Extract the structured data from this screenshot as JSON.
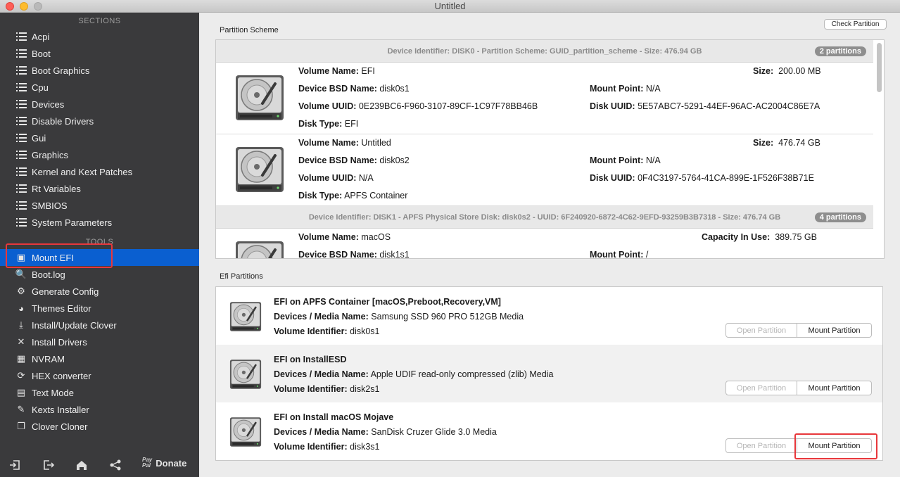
{
  "window": {
    "title": "Untitled"
  },
  "sidebar": {
    "sections_title": "SECTIONS",
    "sections": [
      {
        "label": "Acpi"
      },
      {
        "label": "Boot"
      },
      {
        "label": "Boot Graphics"
      },
      {
        "label": "Cpu"
      },
      {
        "label": "Devices"
      },
      {
        "label": "Disable Drivers"
      },
      {
        "label": "Gui"
      },
      {
        "label": "Graphics"
      },
      {
        "label": "Kernel and Kext Patches"
      },
      {
        "label": "Rt Variables"
      },
      {
        "label": "SMBIOS"
      },
      {
        "label": "System Parameters"
      }
    ],
    "tools_title": "TOOLS",
    "tools": [
      {
        "label": "Mount EFI",
        "icon": "disk-icon",
        "glyph": "▣",
        "active": true
      },
      {
        "label": "Boot.log",
        "icon": "log-icon",
        "glyph": "🔍"
      },
      {
        "label": "Generate Config",
        "icon": "gear-icon",
        "glyph": "⚙"
      },
      {
        "label": "Themes Editor",
        "icon": "palette-icon",
        "glyph": "◕"
      },
      {
        "label": "Install/Update Clover",
        "icon": "download-icon",
        "glyph": "⤓"
      },
      {
        "label": "Install Drivers",
        "icon": "tools-icon",
        "glyph": "✕"
      },
      {
        "label": "NVRAM",
        "icon": "chip-icon",
        "glyph": "▦"
      },
      {
        "label": "HEX converter",
        "icon": "refresh-icon",
        "glyph": "⟳"
      },
      {
        "label": "Text Mode",
        "icon": "text-icon",
        "glyph": "▤"
      },
      {
        "label": "Kexts Installer",
        "icon": "brush-icon",
        "glyph": "✎"
      },
      {
        "label": "Clover Cloner",
        "icon": "clone-icon",
        "glyph": "❐"
      }
    ],
    "bottom": {
      "donate_label": "Donate",
      "paypal_line1": "Pay",
      "paypal_line2": "Pal"
    }
  },
  "main": {
    "check_partition_label": "Check Partition",
    "partition_scheme_label": "Partition Scheme",
    "disk0_header": "Device Identifier: DISK0 - Partition Scheme: GUID_partition_scheme - Size: 476.94 GB",
    "disk0_badge": "2 partitions",
    "disk1_header": "Device Identifier: DISK1 - APFS Physical Store Disk: disk0s2 - UUID: 6F240920-6872-4C62-9EFD-93259B3B7318 - Size: 476.74 GB",
    "disk1_badge": "4 partitions",
    "labels": {
      "volume_name": "Volume Name:",
      "device_bsd": "Device BSD Name:",
      "volume_uuid": "Volume UUID:",
      "disk_type": "Disk Type:",
      "size": "Size:",
      "mount_point": "Mount Point:",
      "disk_uuid": "Disk UUID:",
      "capacity": "Capacity In Use:"
    },
    "volumes": [
      {
        "volume_name": "EFI",
        "device_bsd": "disk0s1",
        "volume_uuid": "0E239BC6-F960-3107-89CF-1C97F78BB46B",
        "disk_type": "EFI",
        "size": "200.00 MB",
        "mount_point": "N/A",
        "disk_uuid": "5E57ABC7-5291-44EF-96AC-AC2004C86E7A"
      },
      {
        "volume_name": "Untitled",
        "device_bsd": "disk0s2",
        "volume_uuid": "N/A",
        "disk_type": "APFS Container",
        "size": "476.74 GB",
        "mount_point": "N/A",
        "disk_uuid": "0F4C3197-5764-41CA-899E-1F526F38B71E"
      },
      {
        "volume_name": "macOS",
        "device_bsd": "disk1s1",
        "capacity": "389.75 GB",
        "mount_point": "/"
      }
    ],
    "efi_partitions_label": "Efi Partitions",
    "efi_labels": {
      "devices_media": "Devices / Media Name:",
      "volume_identifier": "Volume Identifier:"
    },
    "efi": [
      {
        "title": "EFI on APFS Container [macOS,Preboot,Recovery,VM]",
        "media": "Samsung SSD 960 PRO 512GB Media",
        "identifier": "disk0s1",
        "open_label": "Open Partition",
        "mount_label": "Mount Partition"
      },
      {
        "title": "EFI on InstallESD",
        "media": "Apple UDIF read-only compressed (zlib) Media",
        "identifier": "disk2s1",
        "open_label": "Open Partition",
        "mount_label": "Mount Partition"
      },
      {
        "title": "EFI on Install macOS Mojave",
        "media": "SanDisk Cruzer Glide 3.0 Media",
        "identifier": "disk3s1",
        "open_label": "Open Partition",
        "mount_label": "Mount Partition"
      }
    ]
  }
}
